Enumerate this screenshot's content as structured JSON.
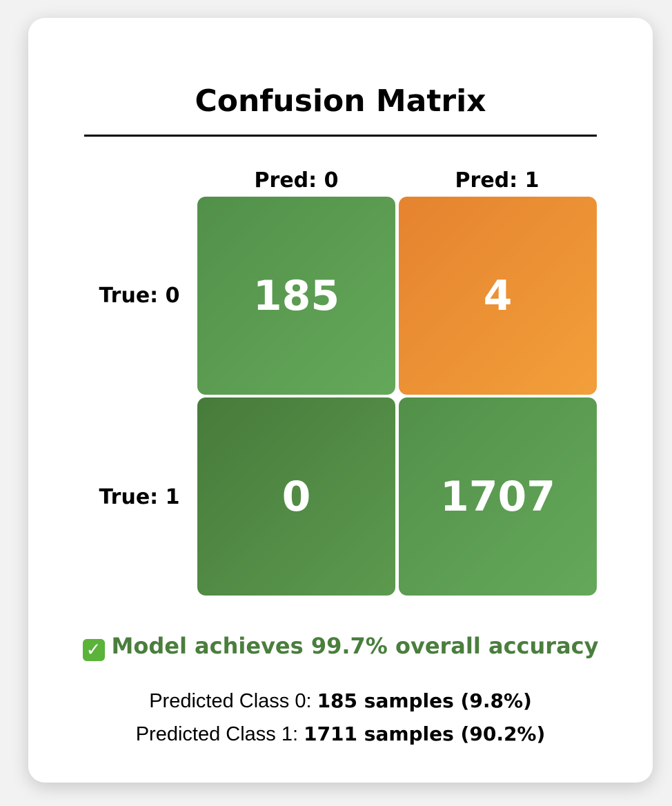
{
  "chart_data": {
    "type": "heatmap",
    "title": "Confusion Matrix",
    "columns": [
      "Pred: 0",
      "Pred: 1"
    ],
    "rows": [
      "True: 0",
      "True: 1"
    ],
    "values": [
      [
        185,
        4
      ],
      [
        0,
        1707
      ]
    ],
    "colors": {
      "correct_start": "#4a7e3d",
      "correct_end": "#64a85a",
      "error_start": "#e5832f",
      "error_end": "#f29f3a"
    }
  },
  "accuracy": {
    "icon": "check-mark-button-icon",
    "text": "Model achieves 99.7% overall accuracy"
  },
  "summary": [
    {
      "label": "Predicted Class 0: ",
      "value": "185 samples (9.8%)"
    },
    {
      "label": "Predicted Class 1: ",
      "value": "1711 samples (90.2%)"
    }
  ]
}
